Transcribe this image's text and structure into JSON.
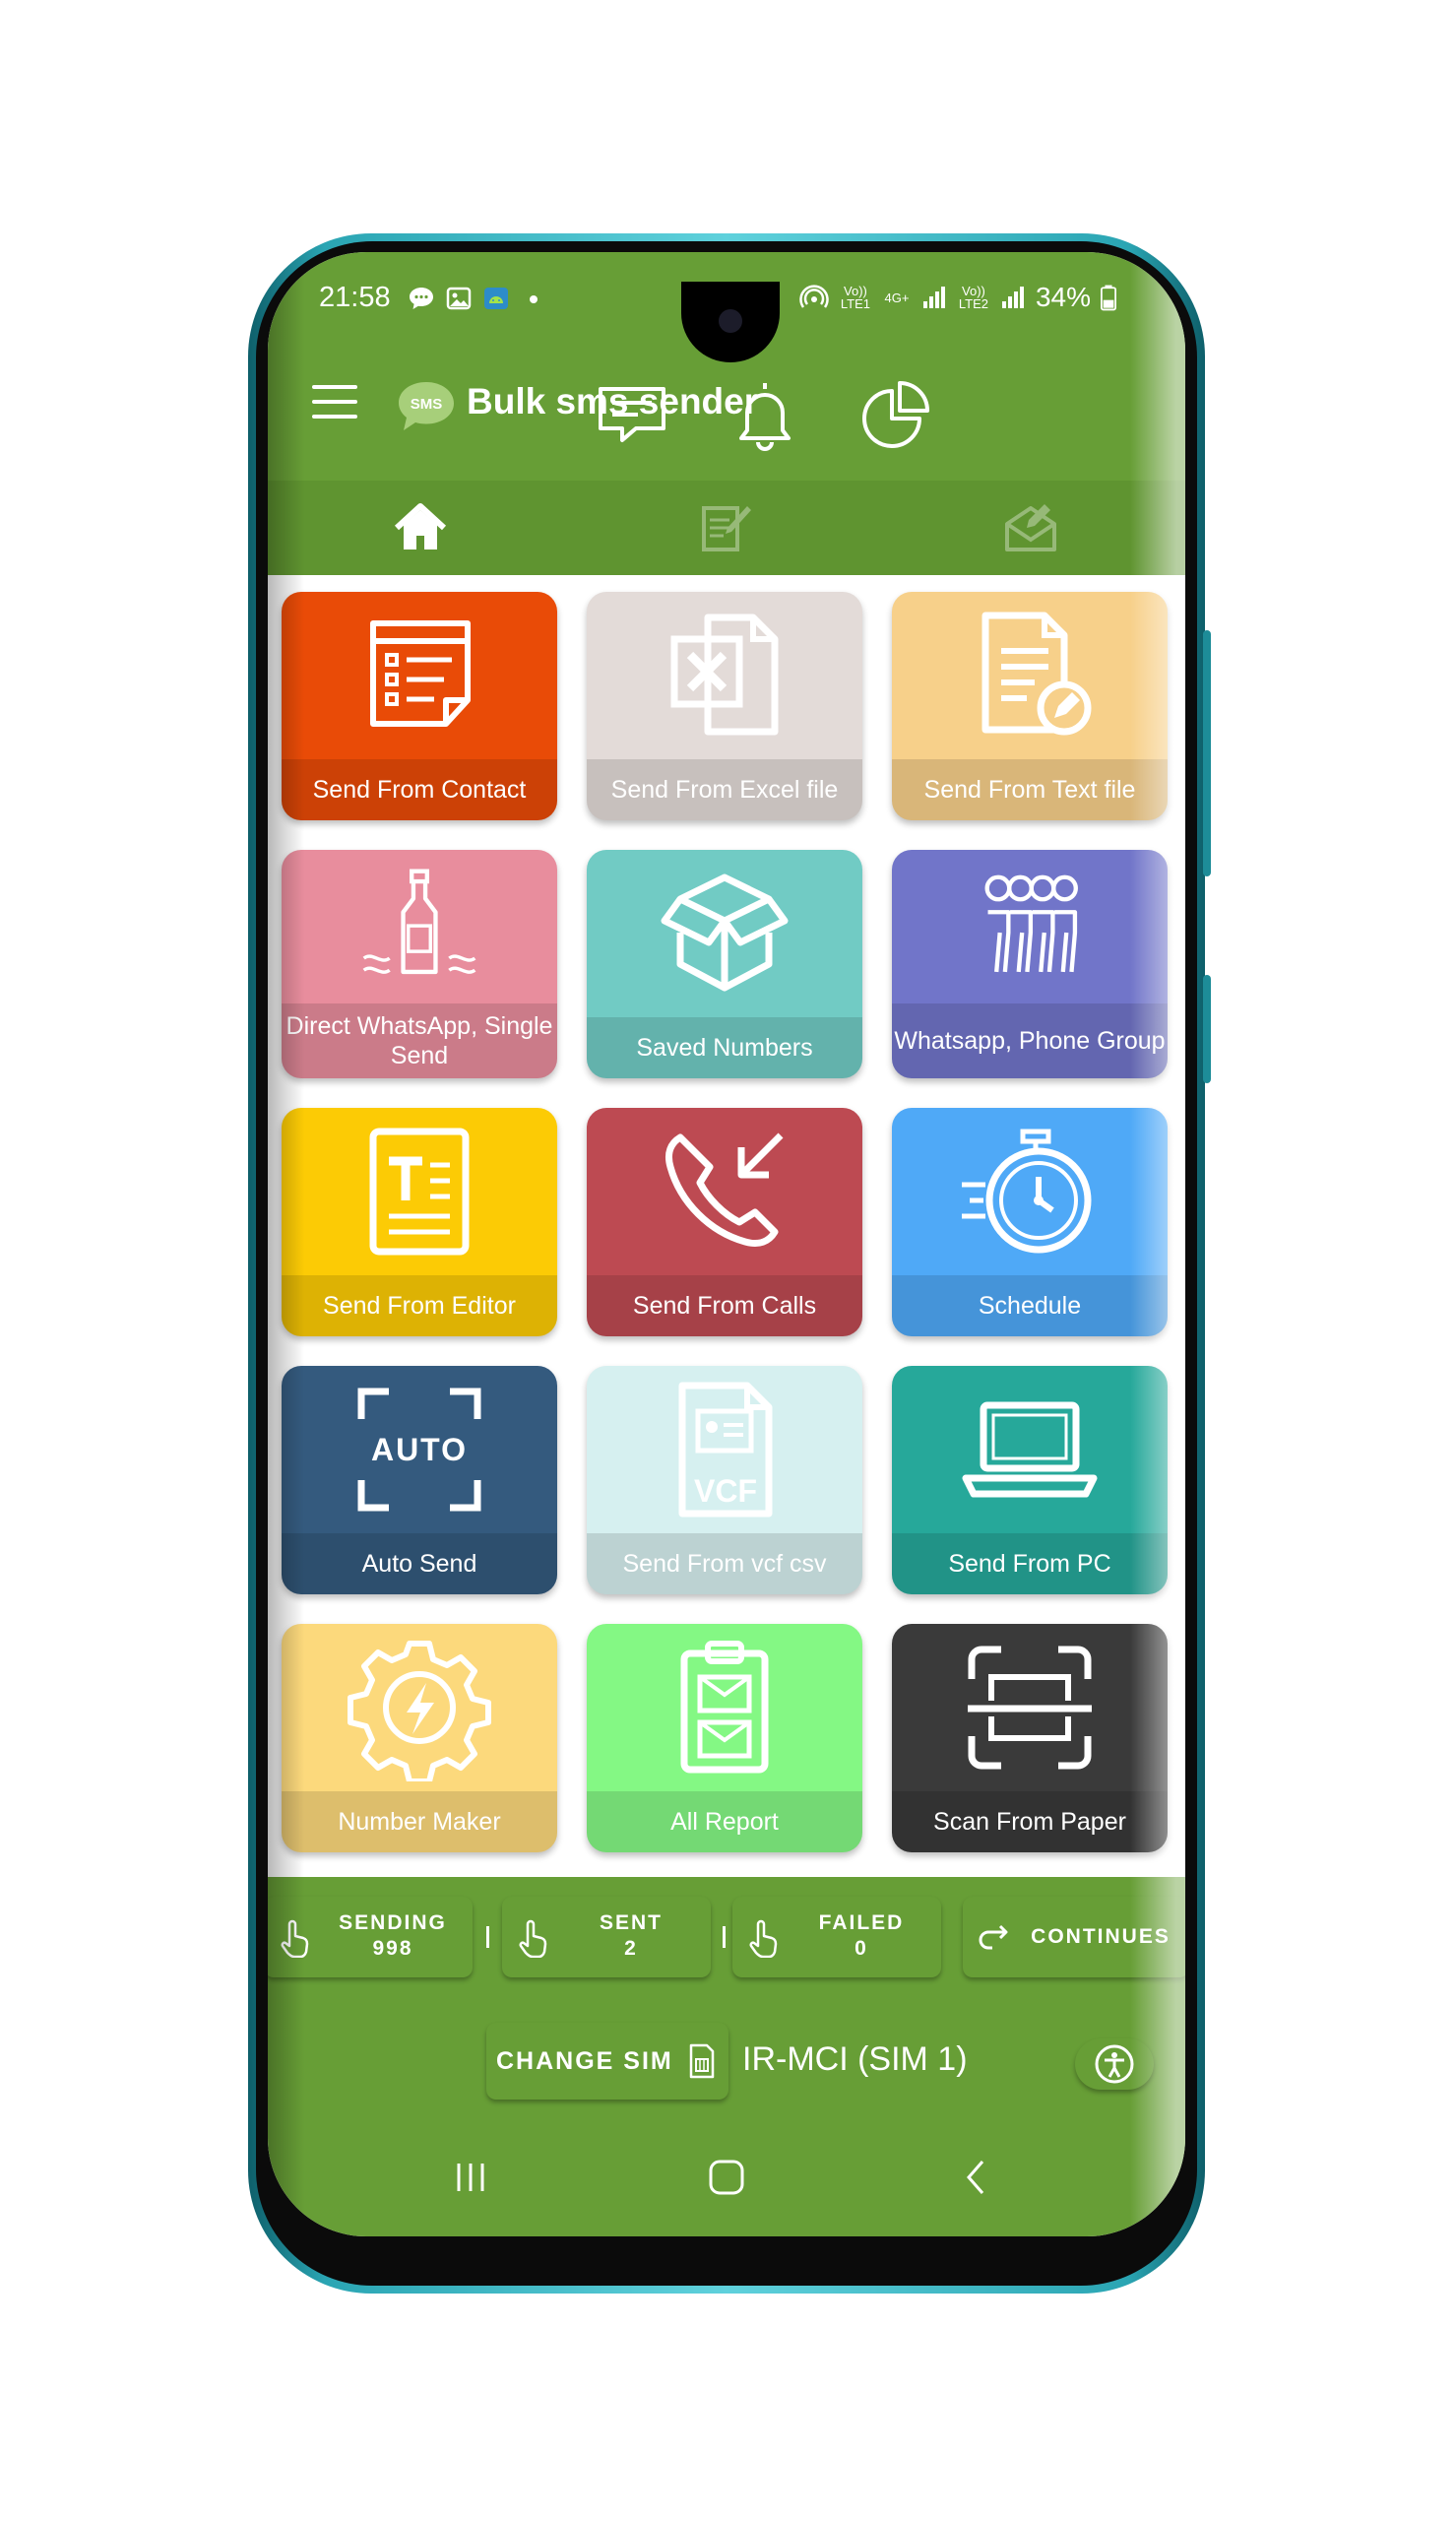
{
  "status_bar": {
    "time": "21:58",
    "battery": "34%",
    "sim1_label": "Vo)) LTE1",
    "net_label": "4G+",
    "sim2_label": "Vo)) LTE2"
  },
  "app_bar": {
    "title": "Bulk sms sender",
    "logo_text": "SMS"
  },
  "tabs": [
    {
      "name": "home",
      "icon": "home-icon",
      "active": true
    },
    {
      "name": "compose",
      "icon": "note-edit-icon",
      "active": false
    },
    {
      "name": "sent",
      "icon": "envelope-edit-icon",
      "active": false
    }
  ],
  "tiles": [
    {
      "label": "Send From Contact",
      "color": "#e94b07",
      "icon": "contact-list-icon"
    },
    {
      "label": "Send From Excel file",
      "color": "#e3dbd8",
      "icon": "excel-file-icon"
    },
    {
      "label": "Send From Text file",
      "color": "#f7d08a",
      "icon": "text-file-icon"
    },
    {
      "label": "Direct WhatsApp, Single Send",
      "color": "#e88d9d",
      "icon": "bottle-icon"
    },
    {
      "label": "Saved Numbers",
      "color": "#71cbc4",
      "icon": "box-icon"
    },
    {
      "label": "Whatsapp, Phone Group",
      "color": "#7175c9",
      "icon": "group-icon"
    },
    {
      "label": "Send From Editor",
      "color": "#fccb05",
      "icon": "editor-icon"
    },
    {
      "label": "Send From Calls",
      "color": "#bd4a52",
      "icon": "incoming-call-icon"
    },
    {
      "label": "Schedule",
      "color": "#4fa9f7",
      "icon": "stopwatch-icon"
    },
    {
      "label": "Auto Send",
      "color": "#345a7e",
      "icon": "auto-icon",
      "icon_text": "AUTO"
    },
    {
      "label": "Send From vcf csv",
      "color": "#d6f0f0",
      "icon": "vcf-file-icon",
      "icon_text": "VCF"
    },
    {
      "label": "Send From PC",
      "color": "#26a89a",
      "icon": "laptop-icon"
    },
    {
      "label": "Number Maker",
      "color": "#fcd97c",
      "icon": "gear-bolt-icon"
    },
    {
      "label": "All Report",
      "color": "#84f884",
      "icon": "report-clipboard-icon"
    },
    {
      "label": "Scan From Paper",
      "color": "#3a3a3a",
      "icon": "scan-icon"
    }
  ],
  "stats": {
    "sending_label": "SENDING",
    "sending_value": "998",
    "sent_label": "SENT",
    "sent_value": "2",
    "failed_label": "FAILED",
    "failed_value": "0",
    "continues_label": "CONTINUES"
  },
  "sim": {
    "change_label": "CHANGE SIM",
    "current": "IR-MCI (SIM 1)"
  },
  "colors": {
    "primary": "#679e36",
    "tab_bar": "#5f9430"
  }
}
